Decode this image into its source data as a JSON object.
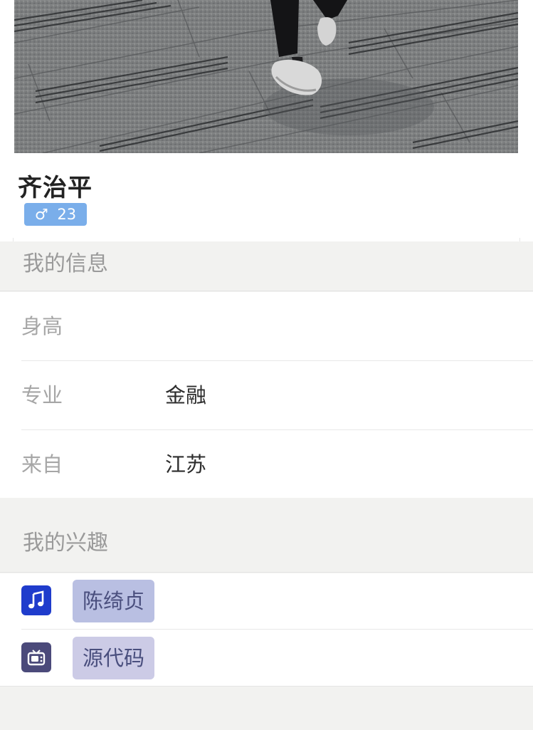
{
  "profile": {
    "name": "齐治平",
    "gender_symbol": "♂",
    "age": "23"
  },
  "info_section": {
    "title": "我的信息",
    "rows": [
      {
        "label": "身高",
        "value": ""
      },
      {
        "label": "专业",
        "value": "金融"
      },
      {
        "label": "来自",
        "value": "江苏"
      }
    ]
  },
  "hobby_section": {
    "title": "我的兴趣",
    "items": [
      {
        "icon": "music-note-icon",
        "label": "陈绮贞",
        "icon_color": "#1f3ccc",
        "tag_color": "#b9bfe2"
      },
      {
        "icon": "tv-icon",
        "label": "源代码",
        "icon_color": "#4b4a7a",
        "tag_color": "#cccbe6"
      }
    ]
  },
  "colors": {
    "gender_badge": "#7aaeea",
    "section_background": "#f2f2f0"
  }
}
